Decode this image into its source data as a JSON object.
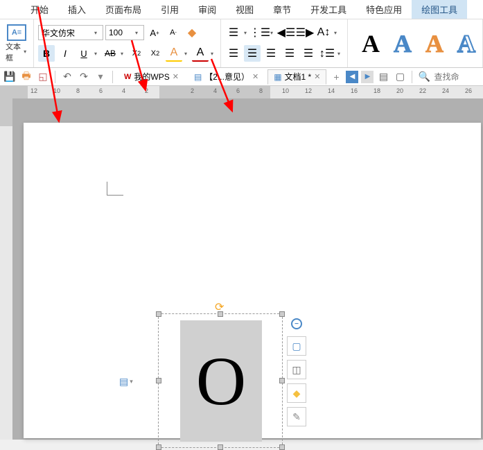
{
  "menu": [
    "开始",
    "插入",
    "页面布局",
    "引用",
    "审阅",
    "视图",
    "章节",
    "开发工具",
    "特色应用",
    "绘图工具"
  ],
  "menu_active": 9,
  "textframe_label": "文本框",
  "font": {
    "name": "华文仿宋",
    "size": "100"
  },
  "format_btns": {
    "bold": "B",
    "italic": "I",
    "underline": "U",
    "strike": "AB"
  },
  "tabs": [
    {
      "label": "我的WPS",
      "type": "wps"
    },
    {
      "label": "【2...意见）",
      "type": "doc"
    },
    {
      "label": "文档1 *",
      "type": "docx",
      "active": true
    }
  ],
  "search": {
    "placeholder": "查找命"
  },
  "ruler_ticks": [
    "12",
    "10",
    "8",
    "6",
    "4",
    "2",
    "",
    "2",
    "4",
    "6",
    "8",
    "10",
    "12",
    "14",
    "16",
    "18",
    "20",
    "22",
    "24",
    "26"
  ],
  "textbox_content": "O"
}
